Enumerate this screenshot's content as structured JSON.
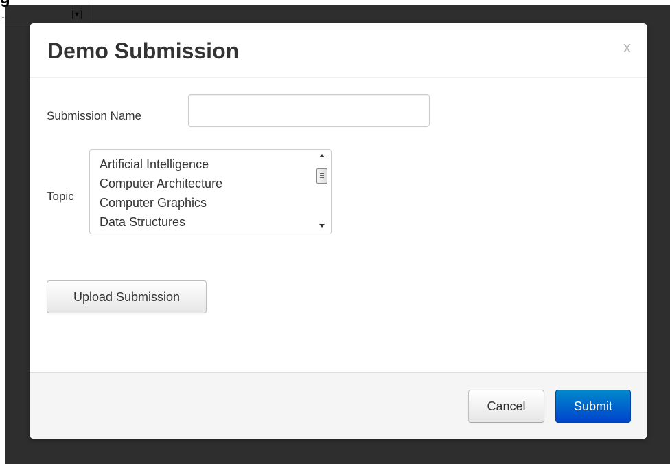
{
  "background_page": {
    "heading_text": "g",
    "select_text": "..."
  },
  "modal": {
    "title": "Demo Submission",
    "close_label": "x",
    "form": {
      "submission_name_label": "Submission Name",
      "submission_name_value": "",
      "submission_name_placeholder": "",
      "topic_label": "Topic",
      "topic_options": [
        "Artificial Intelligence",
        "Computer Architecture",
        "Computer Graphics",
        "Data Structures"
      ],
      "upload_label": "Upload Submission"
    },
    "footer": {
      "cancel_label": "Cancel",
      "submit_label": "Submit"
    }
  },
  "colors": {
    "primary_button": "#0055cc",
    "backdrop": "#2b2b2b",
    "footer_bg": "#f5f5f5"
  },
  "icons": {
    "close": "close-icon",
    "scroll_up": "scroll-up-arrow-icon",
    "scroll_down": "scroll-down-arrow-icon",
    "select_arrow": "chevron-down-icon"
  }
}
